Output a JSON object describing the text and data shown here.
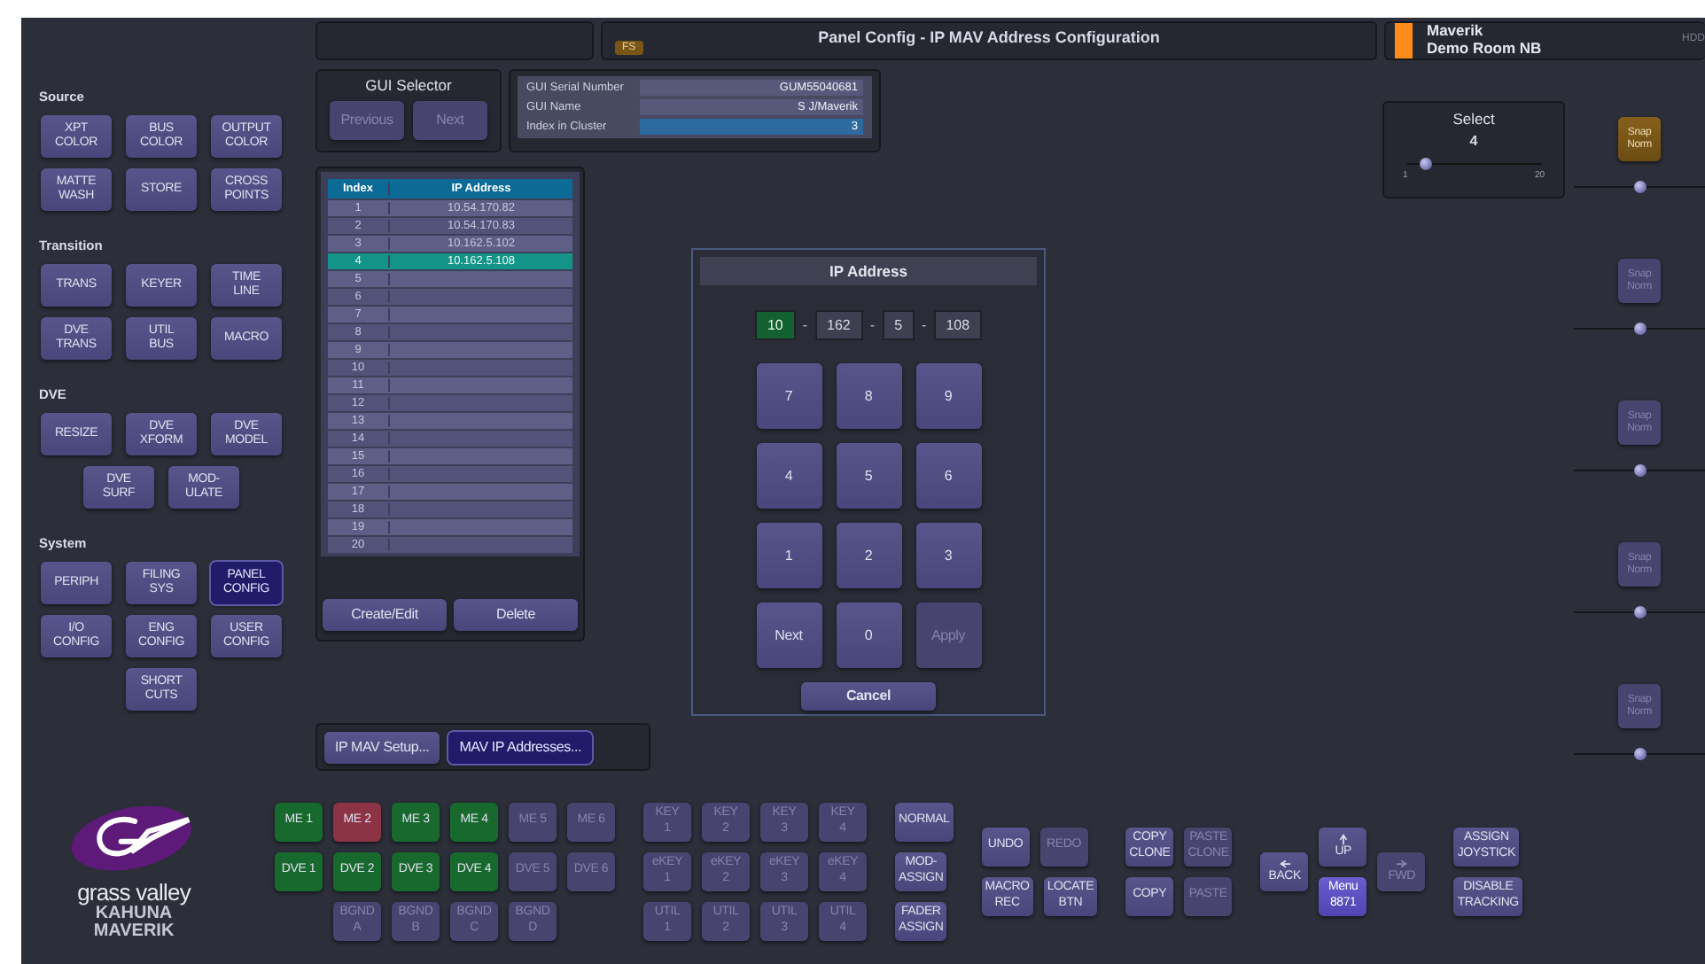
{
  "top_bar": {
    "title": "Panel Config - IP MAV Address Configuration",
    "tag": "FS",
    "device_name": "Maverik",
    "room": "Demo Room NB",
    "hint": "HDD"
  },
  "sidebar": {
    "sections": [
      {
        "title": "Source",
        "rows": [
          [
            {
              "label": "XPT\nCOLOR",
              "selected": false
            },
            {
              "label": "BUS\nCOLOR",
              "selected": false
            },
            {
              "label": "OUTPUT\nCOLOR",
              "selected": false
            }
          ],
          [
            {
              "label": "MATTE\nWASH",
              "selected": false
            },
            {
              "label": "STORE",
              "selected": false
            },
            {
              "label": "CROSS\nPOINTS",
              "selected": false
            }
          ]
        ]
      },
      {
        "title": "Transition",
        "rows": [
          [
            {
              "label": "TRANS",
              "selected": false
            },
            {
              "label": "KEYER",
              "selected": false
            },
            {
              "label": "TIME\nLINE",
              "selected": false
            }
          ],
          [
            {
              "label": "DVE\nTRANS",
              "selected": false
            },
            {
              "label": "UTIL\nBUS",
              "selected": false
            },
            {
              "label": "MACRO",
              "selected": false
            }
          ]
        ]
      },
      {
        "title": "DVE",
        "rows": [
          [
            {
              "label": "RESIZE",
              "selected": false
            },
            {
              "label": "DVE\nXFORM",
              "selected": false
            },
            {
              "label": "DVE\nMODEL",
              "selected": false
            }
          ],
          [
            {
              "label": "DVE\nSURF",
              "selected": false
            },
            {
              "label": "MOD-\nULATE",
              "selected": false
            }
          ]
        ]
      },
      {
        "title": "System",
        "rows": [
          [
            {
              "label": "PERIPH",
              "selected": false
            },
            {
              "label": "FILING\nSYS",
              "selected": false
            },
            {
              "label": "PANEL\nCONFIG",
              "selected": true
            }
          ],
          [
            {
              "label": "I/O\nCONFIG",
              "selected": false
            },
            {
              "label": "ENG\nCONFIG",
              "selected": false
            },
            {
              "label": "USER\nCONFIG",
              "selected": false
            }
          ],
          [
            "",
            {
              "label": "SHORT\nCUTS",
              "selected": false
            }
          ]
        ]
      }
    ],
    "logo": {
      "brand": "grass valley",
      "product": "KAHUNA",
      "model": "MAVERIK"
    }
  },
  "gui_selector": {
    "title": "GUI Selector",
    "buttons": [
      {
        "label": "Previous",
        "disabled": true
      },
      {
        "label": "Next",
        "disabled": true
      }
    ]
  },
  "gui_info": [
    {
      "label": "GUI Serial Number",
      "value": "GUM55040681",
      "selected": false
    },
    {
      "label": "GUI Name",
      "value": "S J/Maverik",
      "selected": false
    },
    {
      "label": "Index in Cluster",
      "value": "3",
      "selected": true
    }
  ],
  "address_table": {
    "columns": [
      "Index",
      "IP Address"
    ],
    "rows": [
      {
        "index": "1",
        "ip": "10.54.170.82",
        "selected": false
      },
      {
        "index": "2",
        "ip": "10.54.170.83",
        "selected": false
      },
      {
        "index": "3",
        "ip": "10.162.5.102",
        "selected": false
      },
      {
        "index": "4",
        "ip": "10.162.5.108",
        "selected": true
      },
      {
        "index": "5",
        "selected": false
      },
      {
        "index": "6",
        "selected": false
      },
      {
        "index": "7",
        "selected": false
      },
      {
        "index": "8",
        "selected": false
      },
      {
        "index": "9",
        "selected": false
      },
      {
        "index": "10",
        "selected": false
      },
      {
        "index": "11",
        "selected": false
      },
      {
        "index": "12",
        "selected": false
      },
      {
        "index": "13",
        "selected": false
      },
      {
        "index": "14",
        "selected": false
      },
      {
        "index": "15",
        "selected": false
      },
      {
        "index": "16",
        "selected": false
      },
      {
        "index": "17",
        "selected": false
      },
      {
        "index": "18",
        "selected": false
      },
      {
        "index": "19",
        "selected": false
      },
      {
        "index": "20",
        "selected": false
      }
    ],
    "buttons": [
      "Create/Edit",
      "Delete"
    ]
  },
  "ip_dialog": {
    "title": "IP Address",
    "octets": [
      {
        "value": "10",
        "selected": true
      },
      {
        "value": "162",
        "selected": false
      },
      {
        "value": "5",
        "selected": false
      },
      {
        "value": "108",
        "selected": false
      }
    ],
    "separators": [
      "-",
      "-",
      "-"
    ],
    "keypad": [
      {
        "label": "7",
        "disabled": false
      },
      {
        "label": "8",
        "disabled": false
      },
      {
        "label": "9",
        "disabled": false
      },
      {
        "label": "4",
        "disabled": false
      },
      {
        "label": "5",
        "disabled": false
      },
      {
        "label": "6",
        "disabled": false
      },
      {
        "label": "1",
        "disabled": false
      },
      {
        "label": "2",
        "disabled": false
      },
      {
        "label": "3",
        "disabled": false
      },
      {
        "label": "Next",
        "disabled": false
      },
      {
        "label": "0",
        "disabled": false
      },
      {
        "label": "Apply",
        "disabled": true
      }
    ],
    "cancel": "Cancel"
  },
  "setup_tabs": [
    {
      "label": "IP MAV Setup...",
      "selected": false
    },
    {
      "label": "MAV IP Addresses...",
      "selected": true
    }
  ],
  "select_control": {
    "title": "Select",
    "value": "4",
    "level": 0.15,
    "min": "1",
    "max": "20"
  },
  "snap_controls": [
    {
      "label": "Snap\nNorm",
      "selected": true,
      "disabled": false,
      "level": 0.5
    },
    {
      "label": "Snap\nNorm",
      "selected": false,
      "disabled": true,
      "level": 0.5
    },
    {
      "label": "Snap\nNorm",
      "selected": false,
      "disabled": true,
      "level": 0.5
    },
    {
      "label": "Snap\nNorm",
      "selected": false,
      "disabled": true,
      "level": 0.5
    },
    {
      "label": "Snap\nNorm",
      "selected": false,
      "disabled": true,
      "level": 0.5
    }
  ],
  "bottom_groups": [
    {
      "kind": "grid",
      "rows": [
        [
          {
            "label": "ME 1",
            "color": "#18692d",
            "disabled": false
          },
          {
            "label": "ME 2",
            "color": "#8c3346",
            "disabled": false
          },
          {
            "label": "ME 3",
            "color": "#18692d",
            "disabled": false
          },
          {
            "label": "ME 4",
            "color": "#18692d",
            "disabled": false
          },
          {
            "label": "ME 5",
            "color": "#47456f",
            "disabled": true
          },
          {
            "label": "ME 6",
            "color": "#47456f",
            "disabled": true
          }
        ],
        [
          {
            "label": "DVE 1",
            "color": "#18692d",
            "disabled": false
          },
          {
            "label": "DVE 2",
            "color": "#18692d",
            "disabled": false
          },
          {
            "label": "DVE 3",
            "color": "#18692d",
            "disabled": false
          },
          {
            "label": "DVE 4",
            "color": "#18692d",
            "disabled": false
          },
          {
            "label": "DVE 5",
            "color": "#47456f",
            "disabled": true
          },
          {
            "label": "DVE 6",
            "color": "#47456f",
            "disabled": true
          }
        ],
        [
          "",
          {
            "label": "BGND\nA",
            "color": "#47456f",
            "disabled": true
          },
          {
            "label": "BGND\nB",
            "color": "#47456f",
            "disabled": true
          },
          {
            "label": "BGND\nC",
            "color": "#47456f",
            "disabled": true
          },
          {
            "label": "BGND\nD",
            "color": "#47456f",
            "disabled": true
          }
        ]
      ]
    },
    {
      "kind": "grid",
      "rows": [
        [
          {
            "label": "KEY\n1",
            "disabled": true
          },
          {
            "label": "KEY\n2",
            "disabled": true
          },
          {
            "label": "KEY\n3",
            "disabled": true
          },
          {
            "label": "KEY\n4",
            "disabled": true
          }
        ],
        [
          {
            "label": "eKEY\n1",
            "disabled": true
          },
          {
            "label": "eKEY\n2",
            "disabled": true
          },
          {
            "label": "eKEY\n3",
            "disabled": true
          },
          {
            "label": "eKEY\n4",
            "disabled": true
          }
        ],
        [
          {
            "label": "UTIL\n1",
            "disabled": true
          },
          {
            "label": "UTIL\n2",
            "disabled": true
          },
          {
            "label": "UTIL\n3",
            "disabled": true
          },
          {
            "label": "UTIL\n4",
            "disabled": true
          }
        ]
      ]
    },
    {
      "kind": "grid",
      "rows": [
        [
          {
            "label": "NORMAL",
            "disabled": false
          }
        ],
        [
          {
            "label": "MOD-\nASSIGN",
            "disabled": false
          }
        ],
        [
          {
            "label": "FADER\nASSIGN",
            "disabled": false
          }
        ]
      ]
    },
    {
      "kind": "grid",
      "rows": [
        [
          {
            "label": "UNDO",
            "disabled": false
          },
          {
            "label": "REDO",
            "disabled": true
          }
        ],
        [
          {
            "label": "MACRO\nREC",
            "disabled": false
          },
          {
            "label": "LOCATE\nBTN",
            "disabled": false
          }
        ]
      ]
    },
    {
      "kind": "grid",
      "rows": [
        [
          {
            "label": "COPY\nCLONE",
            "disabled": false
          },
          {
            "label": "PASTE\nCLONE",
            "disabled": true
          }
        ],
        [
          {
            "label": "COPY",
            "disabled": false
          },
          {
            "label": "PASTE",
            "disabled": true
          }
        ]
      ]
    },
    {
      "kind": "nav",
      "items": [
        {
          "label": "BACK",
          "disabled": false,
          "selected": false
        },
        {
          "label": "UP",
          "disabled": false,
          "selected": false
        },
        {
          "label": "Menu\n8871",
          "disabled": false,
          "selected": true
        },
        {
          "label": "FWD",
          "disabled": true,
          "selected": false
        }
      ]
    },
    {
      "kind": "grid",
      "rows": [
        [
          {
            "label": "ASSIGN\nJOYSTICK",
            "disabled": false
          }
        ],
        [
          {
            "label": "DISABLE\nTRACKING",
            "disabled": false
          }
        ]
      ]
    }
  ]
}
